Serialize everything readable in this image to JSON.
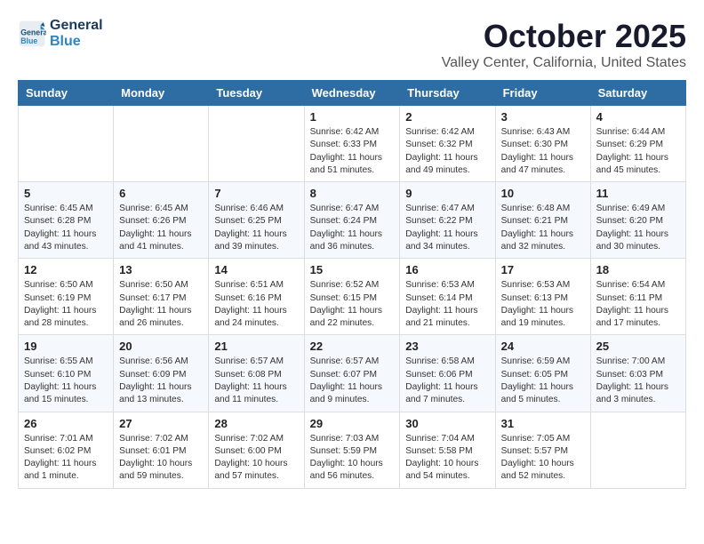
{
  "logo": {
    "line1": "General",
    "line2": "Blue"
  },
  "title": "October 2025",
  "location": "Valley Center, California, United States",
  "weekdays": [
    "Sunday",
    "Monday",
    "Tuesday",
    "Wednesday",
    "Thursday",
    "Friday",
    "Saturday"
  ],
  "weeks": [
    [
      {
        "day": "",
        "info": ""
      },
      {
        "day": "",
        "info": ""
      },
      {
        "day": "",
        "info": ""
      },
      {
        "day": "1",
        "info": "Sunrise: 6:42 AM\nSunset: 6:33 PM\nDaylight: 11 hours\nand 51 minutes."
      },
      {
        "day": "2",
        "info": "Sunrise: 6:42 AM\nSunset: 6:32 PM\nDaylight: 11 hours\nand 49 minutes."
      },
      {
        "day": "3",
        "info": "Sunrise: 6:43 AM\nSunset: 6:30 PM\nDaylight: 11 hours\nand 47 minutes."
      },
      {
        "day": "4",
        "info": "Sunrise: 6:44 AM\nSunset: 6:29 PM\nDaylight: 11 hours\nand 45 minutes."
      }
    ],
    [
      {
        "day": "5",
        "info": "Sunrise: 6:45 AM\nSunset: 6:28 PM\nDaylight: 11 hours\nand 43 minutes."
      },
      {
        "day": "6",
        "info": "Sunrise: 6:45 AM\nSunset: 6:26 PM\nDaylight: 11 hours\nand 41 minutes."
      },
      {
        "day": "7",
        "info": "Sunrise: 6:46 AM\nSunset: 6:25 PM\nDaylight: 11 hours\nand 39 minutes."
      },
      {
        "day": "8",
        "info": "Sunrise: 6:47 AM\nSunset: 6:24 PM\nDaylight: 11 hours\nand 36 minutes."
      },
      {
        "day": "9",
        "info": "Sunrise: 6:47 AM\nSunset: 6:22 PM\nDaylight: 11 hours\nand 34 minutes."
      },
      {
        "day": "10",
        "info": "Sunrise: 6:48 AM\nSunset: 6:21 PM\nDaylight: 11 hours\nand 32 minutes."
      },
      {
        "day": "11",
        "info": "Sunrise: 6:49 AM\nSunset: 6:20 PM\nDaylight: 11 hours\nand 30 minutes."
      }
    ],
    [
      {
        "day": "12",
        "info": "Sunrise: 6:50 AM\nSunset: 6:19 PM\nDaylight: 11 hours\nand 28 minutes."
      },
      {
        "day": "13",
        "info": "Sunrise: 6:50 AM\nSunset: 6:17 PM\nDaylight: 11 hours\nand 26 minutes."
      },
      {
        "day": "14",
        "info": "Sunrise: 6:51 AM\nSunset: 6:16 PM\nDaylight: 11 hours\nand 24 minutes."
      },
      {
        "day": "15",
        "info": "Sunrise: 6:52 AM\nSunset: 6:15 PM\nDaylight: 11 hours\nand 22 minutes."
      },
      {
        "day": "16",
        "info": "Sunrise: 6:53 AM\nSunset: 6:14 PM\nDaylight: 11 hours\nand 21 minutes."
      },
      {
        "day": "17",
        "info": "Sunrise: 6:53 AM\nSunset: 6:13 PM\nDaylight: 11 hours\nand 19 minutes."
      },
      {
        "day": "18",
        "info": "Sunrise: 6:54 AM\nSunset: 6:11 PM\nDaylight: 11 hours\nand 17 minutes."
      }
    ],
    [
      {
        "day": "19",
        "info": "Sunrise: 6:55 AM\nSunset: 6:10 PM\nDaylight: 11 hours\nand 15 minutes."
      },
      {
        "day": "20",
        "info": "Sunrise: 6:56 AM\nSunset: 6:09 PM\nDaylight: 11 hours\nand 13 minutes."
      },
      {
        "day": "21",
        "info": "Sunrise: 6:57 AM\nSunset: 6:08 PM\nDaylight: 11 hours\nand 11 minutes."
      },
      {
        "day": "22",
        "info": "Sunrise: 6:57 AM\nSunset: 6:07 PM\nDaylight: 11 hours\nand 9 minutes."
      },
      {
        "day": "23",
        "info": "Sunrise: 6:58 AM\nSunset: 6:06 PM\nDaylight: 11 hours\nand 7 minutes."
      },
      {
        "day": "24",
        "info": "Sunrise: 6:59 AM\nSunset: 6:05 PM\nDaylight: 11 hours\nand 5 minutes."
      },
      {
        "day": "25",
        "info": "Sunrise: 7:00 AM\nSunset: 6:03 PM\nDaylight: 11 hours\nand 3 minutes."
      }
    ],
    [
      {
        "day": "26",
        "info": "Sunrise: 7:01 AM\nSunset: 6:02 PM\nDaylight: 11 hours\nand 1 minute."
      },
      {
        "day": "27",
        "info": "Sunrise: 7:02 AM\nSunset: 6:01 PM\nDaylight: 10 hours\nand 59 minutes."
      },
      {
        "day": "28",
        "info": "Sunrise: 7:02 AM\nSunset: 6:00 PM\nDaylight: 10 hours\nand 57 minutes."
      },
      {
        "day": "29",
        "info": "Sunrise: 7:03 AM\nSunset: 5:59 PM\nDaylight: 10 hours\nand 56 minutes."
      },
      {
        "day": "30",
        "info": "Sunrise: 7:04 AM\nSunset: 5:58 PM\nDaylight: 10 hours\nand 54 minutes."
      },
      {
        "day": "31",
        "info": "Sunrise: 7:05 AM\nSunset: 5:57 PM\nDaylight: 10 hours\nand 52 minutes."
      },
      {
        "day": "",
        "info": ""
      }
    ]
  ]
}
